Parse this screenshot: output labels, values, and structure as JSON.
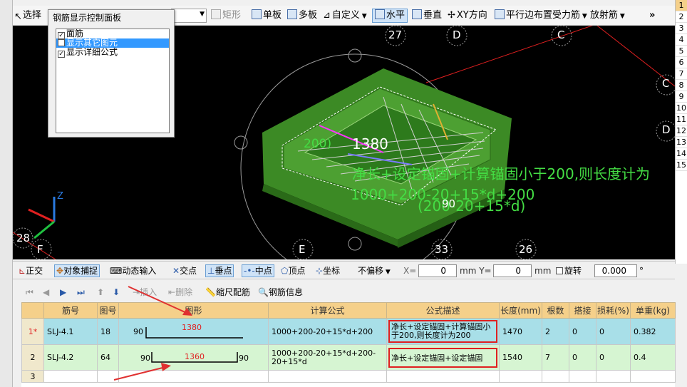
{
  "toolbar": {
    "select_label": "选择",
    "rect_label": "矩形",
    "single_board": "单板",
    "multi_board": "多板",
    "custom": "自定义",
    "horizontal": "水平",
    "vertical": "垂直",
    "xy_direction": "XY方向",
    "parallel_edge": "平行边布置受力筋",
    "radial": "放射筋",
    "more": "»"
  },
  "panel": {
    "title": "钢筋显示控制面板",
    "items": [
      {
        "label": "面筋",
        "checked": "✓"
      },
      {
        "label": "显示其它图元",
        "checked": ""
      },
      {
        "label": "显示详细公式",
        "checked": "✓"
      }
    ]
  },
  "viewport": {
    "axis_labels": [
      "27",
      "D",
      "C",
      "C",
      "D",
      "F",
      "E",
      "33",
      "26",
      "28"
    ],
    "dim_text": "1380",
    "dim_small": "200)",
    "formula_overlay_1": "净长+设定锚固+计算锚固小于200,则长度计为",
    "formula_overlay_2": "1000+200-20+15*d+200",
    "formula_overlay_3": "(200-20+15*d)",
    "value_90": "90",
    "axis_z": "Z"
  },
  "right_rows": [
    "1",
    "2",
    "3",
    "4",
    "5",
    "6",
    "7",
    "8",
    "9",
    "10",
    "11",
    "12",
    "13",
    "14",
    "15"
  ],
  "snapbar": {
    "orthogonal": "正交",
    "object_snap": "对象捕捉",
    "dynamic_input": "动态输入",
    "intersection": "交点",
    "perpendicular": "垂点",
    "midpoint": "中点",
    "vertex": "顶点",
    "coordinate": "坐标",
    "offset": "不偏移",
    "x_label": "X=",
    "x_value": "0",
    "y_label": "mm Y=",
    "y_value": "0",
    "mm": "mm",
    "rotate": "旋转",
    "rotate_value": "0.000",
    "degree": "°"
  },
  "rebarbar": {
    "insert": "插入",
    "delete": "删除",
    "scale": "缩尺配筋",
    "info": "钢筋信息"
  },
  "table": {
    "headers": [
      "筋号",
      "图号",
      "图形",
      "计算公式",
      "公式描述",
      "长度(mm)",
      "根数",
      "搭接",
      "损耗(%)",
      "单重(kg)"
    ],
    "rows": [
      {
        "num": "1*",
        "name": "SLJ-4.1",
        "fig": "18",
        "left": "90",
        "mid": "1380",
        "right": "",
        "formula": "1000+200-20+15*d+200",
        "desc": "净长+设定锚固+计算锚固小于200,则长度计为200",
        "length": "1470",
        "count": "2",
        "lap": "0",
        "loss": "0",
        "weight": "0.382"
      },
      {
        "num": "2",
        "name": "SLJ-4.2",
        "fig": "64",
        "left": "90",
        "mid": "1360",
        "right": "90",
        "formula": "1000+200-20+15*d+200-20+15*d",
        "desc": "净长+设定锚固+设定锚固",
        "length": "1540",
        "count": "7",
        "lap": "0",
        "loss": "0",
        "weight": "0.4"
      },
      {
        "num": "3"
      }
    ]
  }
}
